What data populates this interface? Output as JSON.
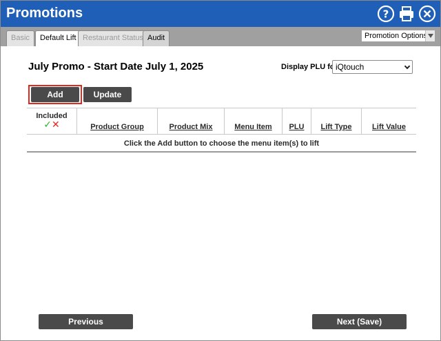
{
  "window": {
    "title": "Promotions"
  },
  "titlebar_icons": [
    {
      "name": "help-icon",
      "glyph": "?"
    },
    {
      "name": "print-icon"
    },
    {
      "name": "close-icon"
    }
  ],
  "tabs": [
    {
      "label": "Basic",
      "state": "disabled"
    },
    {
      "label": "Default Lift",
      "state": "active"
    },
    {
      "label": "Restaurant Status",
      "state": "disabled"
    },
    {
      "label": "Audit",
      "state": "normal"
    }
  ],
  "promotion_options": {
    "label": "Promotion Options"
  },
  "header": {
    "title": "July Promo - Start Date July 1, 2025"
  },
  "plu": {
    "label": "Display PLU for",
    "selected": "iQtouch"
  },
  "actions": {
    "add_label": "Add",
    "update_label": "Update"
  },
  "grid": {
    "included_label": "Included",
    "included_check": "✓",
    "included_cross": "✕",
    "columns": [
      "Product Group",
      "Product Mix",
      "Menu Item",
      "PLU",
      "Lift Type",
      "Lift Value"
    ],
    "empty_message": "Click the Add button to choose the menu item(s) to lift"
  },
  "footer": {
    "previous_label": "Previous",
    "next_label": "Next (Save)"
  },
  "colors": {
    "titlebar": "#1f5fb8",
    "tabbar": "#a0a0a0",
    "button": "#4a4a4a",
    "highlight": "#e0281e",
    "check": "#2db52d",
    "cross": "#e0281e"
  }
}
